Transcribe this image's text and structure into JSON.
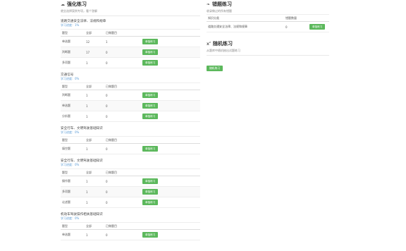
{
  "left": {
    "title": "强化练习",
    "title_icon": "cloud-icon",
    "desc": "就业选择案例专项，看个答解",
    "headers": [
      "题型",
      "全部",
      "已做题目",
      ""
    ],
    "btn_label": "单独练习",
    "sections": [
      {
        "title": "道路交通安全法律、法规和规章",
        "progress": "学习进度：1%",
        "rows": [
          {
            "type": "单选题",
            "total": "12",
            "done": "1"
          },
          {
            "type": "判断题",
            "total": "17",
            "done": "0"
          },
          {
            "type": "多项题",
            "total": "1",
            "done": "0"
          }
        ]
      },
      {
        "title": "交通信号",
        "progress": "学习进度：0%",
        "rows": [
          {
            "type": "判断题",
            "total": "1",
            "done": "0"
          },
          {
            "type": "单选题",
            "total": "1",
            "done": "0"
          },
          {
            "type": "分析题",
            "total": "1",
            "done": "0"
          }
        ]
      },
      {
        "title": "安全行车、文明驾驶基础知识",
        "progress": "学习进度：0%",
        "rows": [
          {
            "type": "填空题",
            "total": "1",
            "done": "0"
          }
        ]
      },
      {
        "title": "安全行车、文明驾驶基础知识",
        "progress": "学习进度：0%",
        "rows": [
          {
            "type": "操作题",
            "total": "1",
            "done": "0"
          },
          {
            "type": "多项题",
            "total": "1",
            "done": "0"
          },
          {
            "type": "论述题",
            "total": "1",
            "done": "0"
          }
        ]
      },
      {
        "title": "机动车驾驶操作相关基础知识",
        "progress": "学习进度：0%",
        "rows": [
          {
            "type": "单选题",
            "total": "1",
            "done": "0"
          }
        ]
      }
    ]
  },
  "right": {
    "wrong": {
      "title": "错题练习",
      "title_icon": "leaf-icon",
      "desc": "收录做过的所有错题",
      "headers": [
        "知识分类",
        "错题数量",
        ""
      ],
      "rows": [
        {
          "category": "道路交通安全法律、法规和规章",
          "count": "0"
        }
      ],
      "btn_label": "单独练习"
    },
    "random": {
      "title": "随机练习",
      "title_icon": "random-icon",
      "desc": "从题库中随机抽出试题练习",
      "btn_label": "随机练习"
    }
  }
}
